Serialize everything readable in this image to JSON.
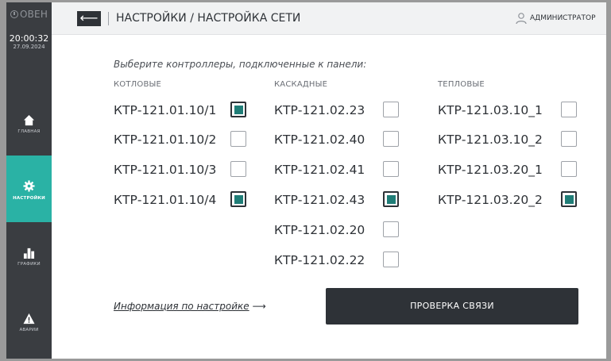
{
  "sidebar": {
    "brand": "ОВЕН",
    "time": "20:00:32",
    "date": "27.09.2024",
    "items": [
      {
        "label": "ГЛАВНАЯ",
        "icon": "home-icon"
      },
      {
        "label": "НАСТРОЙКИ",
        "icon": "gear-icon"
      },
      {
        "label": "ГРАФИКИ",
        "icon": "bar-chart-icon"
      },
      {
        "label": "АВАРИИ",
        "icon": "warning-icon"
      }
    ],
    "active_color": "#2ab2a5"
  },
  "header": {
    "back_label": "⟵",
    "title": "НАСТРОЙКИ / НАСТРОЙКА СЕТИ",
    "user": "АДМИНИСТРАТОР"
  },
  "main": {
    "prompt": "Выберите контроллеры, подключенные к панели:",
    "columns": [
      {
        "title": "КОТЛОВЫЕ",
        "items": [
          {
            "name": "КТР-121.01.10/1",
            "checked": true
          },
          {
            "name": "КТР-121.01.10/2",
            "checked": false
          },
          {
            "name": "КТР-121.01.10/3",
            "checked": false
          },
          {
            "name": "КТР-121.01.10/4",
            "checked": true
          }
        ]
      },
      {
        "title": "КАСКАДНЫЕ",
        "items": [
          {
            "name": "КТР-121.02.23",
            "checked": false
          },
          {
            "name": "КТР-121.02.40",
            "checked": false
          },
          {
            "name": "КТР-121.02.41",
            "checked": false
          },
          {
            "name": "КТР-121.02.43",
            "checked": true
          },
          {
            "name": "КТР-121.02.20",
            "checked": false
          },
          {
            "name": "КТР-121.02.22",
            "checked": false
          }
        ]
      },
      {
        "title": "ТЕПЛОВЫЕ",
        "items": [
          {
            "name": "КТР-121.03.10_1",
            "checked": false
          },
          {
            "name": "КТР-121.03.10_2",
            "checked": false
          },
          {
            "name": "КТР-121.03.20_1",
            "checked": false
          },
          {
            "name": "КТР-121.03.20_2",
            "checked": true
          }
        ]
      }
    ],
    "info_link": "Информация по настройке",
    "info_arrow": "⟶",
    "check_button": "ПРОВЕРКА СВЯЗИ"
  }
}
